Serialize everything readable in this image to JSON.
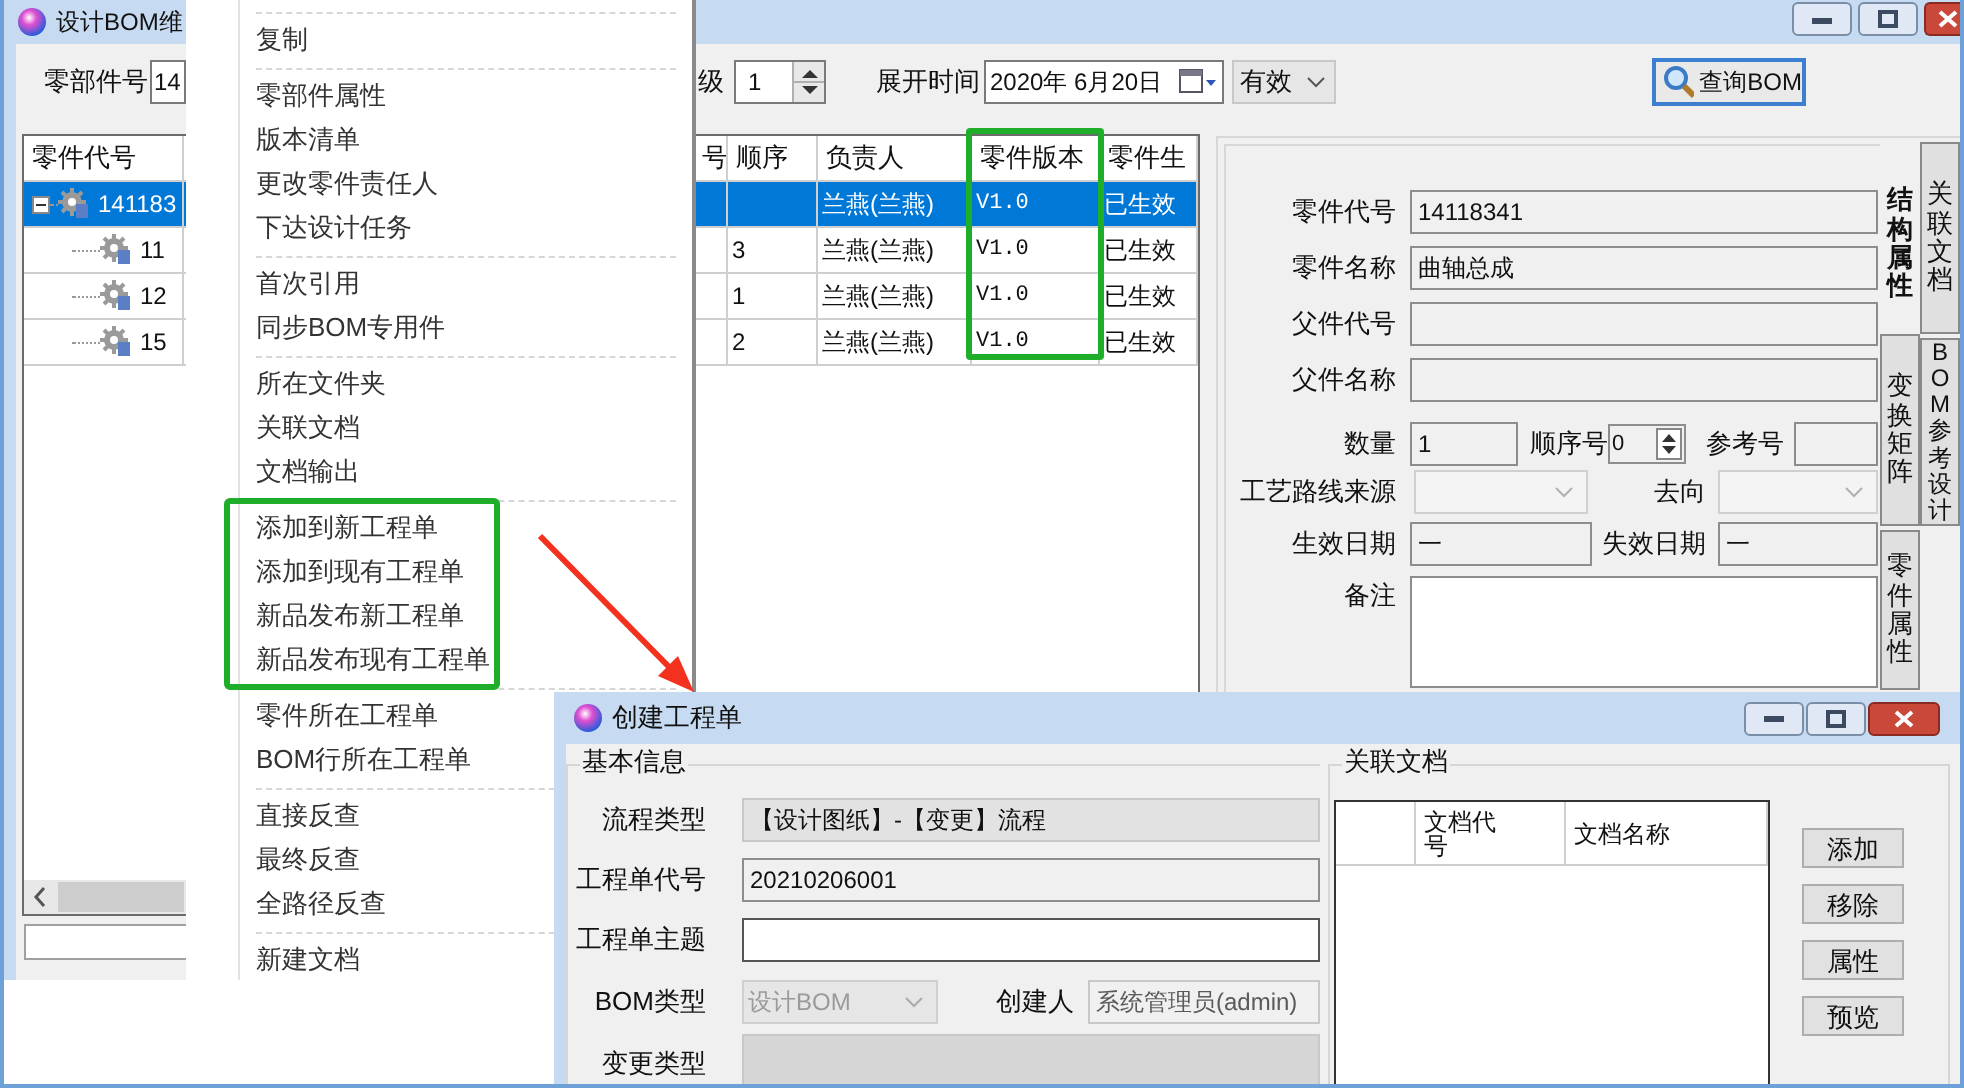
{
  "main_window": {
    "title": "设计BOM维"
  },
  "toolbar": {
    "part_number": {
      "label": "零部件号",
      "value": "14"
    },
    "level": {
      "label": "级",
      "value": "1"
    },
    "expand_time": {
      "label": "展开时间",
      "date": "2020年 6月20日"
    },
    "validity": {
      "value": "有效"
    },
    "query_button": {
      "label": "查询BOM"
    }
  },
  "bom_table": {
    "columns": [
      {
        "label": "零件代号",
        "highlighted": false
      },
      {
        "label": "号",
        "highlighted": false
      },
      {
        "label": "顺序",
        "highlighted": false
      },
      {
        "label": "负责人",
        "highlighted": false
      },
      {
        "label": "零件版本",
        "highlighted": true
      },
      {
        "label": "零件生",
        "highlighted": false
      }
    ],
    "rows": [
      {
        "part_code": "141183",
        "expanded": true,
        "selected": true,
        "owner": "兰燕(兰燕)",
        "version": "V1.0",
        "status": "已生效",
        "children": [
          {
            "part_code": "11",
            "selected": false,
            "sequence": "3",
            "owner": "兰燕(兰燕)",
            "version": "V1.0",
            "status": "已生效"
          },
          {
            "part_code": "12",
            "selected": false,
            "sequence": "1",
            "owner": "兰燕(兰燕)",
            "version": "V1.0",
            "status": "已生效"
          },
          {
            "part_code": "15",
            "selected": false,
            "sequence": "2",
            "owner": "兰燕(兰燕)",
            "version": "V1.0",
            "status": "已生效"
          }
        ]
      }
    ]
  },
  "properties_panel": {
    "part_code": {
      "label": "零件代号",
      "value": "14118341"
    },
    "part_name": {
      "label": "零件名称",
      "value": "曲轴总成"
    },
    "parent_code": {
      "label": "父件代号"
    },
    "parent_name": {
      "label": "父件名称"
    },
    "quantity": {
      "label": "数量",
      "value": "1"
    },
    "sequence": {
      "label": "顺序号",
      "value": "0"
    },
    "reference": {
      "label": "参考号"
    },
    "route_source": {
      "label": "工艺路线来源",
      "disabled": true
    },
    "direction": {
      "label": "去向",
      "disabled": true
    },
    "effective_date": {
      "label": "生效日期",
      "value": "一"
    },
    "expiry_date": {
      "label": "失效日期",
      "value": "一"
    },
    "remarks": {
      "label": "备注"
    }
  },
  "side_tabs": {
    "inner": [
      {
        "label": "结构属性",
        "selected": true
      },
      {
        "label": "变换矩阵",
        "selected": false
      },
      {
        "label": "零件属性",
        "selected": false
      }
    ],
    "outer": [
      {
        "label": "关联文档",
        "selected": false
      },
      {
        "label": "BOM参考设计",
        "selected": false
      }
    ]
  },
  "context_menu": {
    "groups": [
      {
        "highlighted": false,
        "items": [
          "复制"
        ]
      },
      {
        "highlighted": false,
        "items": [
          "零部件属性",
          "版本清单",
          "更改零件责任人",
          "下达设计任务"
        ]
      },
      {
        "highlighted": false,
        "items": [
          "首次引用",
          "同步BOM专用件"
        ]
      },
      {
        "highlighted": false,
        "items": [
          "所在文件夹",
          "关联文档",
          "文档输出"
        ]
      },
      {
        "highlighted": true,
        "items": [
          "添加到新工程单",
          "添加到现有工程单",
          "新品发布新工程单",
          "新品发布现有工程单"
        ]
      },
      {
        "highlighted": false,
        "items": [
          "零件所在工程单",
          "BOM行所在工程单"
        ]
      },
      {
        "highlighted": false,
        "items": [
          "直接反查",
          "最终反查",
          "全路径反查"
        ]
      },
      {
        "highlighted": false,
        "items": [
          "新建文档"
        ]
      }
    ]
  },
  "dialog": {
    "title": "创建工程单",
    "basic_info": {
      "title": "基本信息",
      "process_type": {
        "label": "流程类型",
        "value": "【设计图纸】-【变更】流程"
      },
      "order_code": {
        "label": "工程单代号",
        "value": "20210206001"
      },
      "subject": {
        "label": "工程单主题"
      },
      "bom_type": {
        "label": "BOM类型",
        "value": "设计BOM",
        "disabled": true
      },
      "creator": {
        "label": "创建人",
        "value": "系统管理员(admin)"
      },
      "change_type": {
        "label": "变更类型"
      }
    },
    "related_docs": {
      "title": "关联文档",
      "columns": [
        {
          "label": "文档代号"
        },
        {
          "label": "文档名称"
        }
      ],
      "buttons": [
        "添加",
        "移除",
        "属性",
        "预览"
      ]
    }
  }
}
